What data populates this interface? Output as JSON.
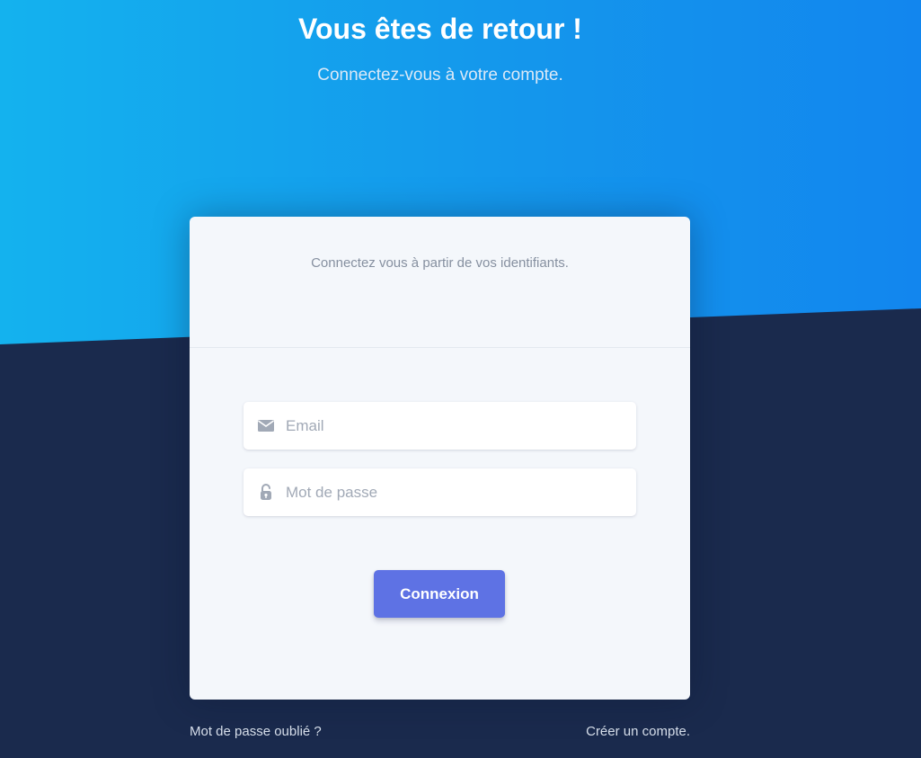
{
  "hero": {
    "title": "Vous êtes de retour !",
    "subtitle": "Connectez-vous à votre compte."
  },
  "card": {
    "header_text": "Connectez vous à partir de vos identifiants.",
    "email": {
      "placeholder": "Email",
      "value": "",
      "icon": "envelope-icon"
    },
    "password": {
      "placeholder": "Mot de passe",
      "value": "",
      "icon": "lock-icon"
    },
    "submit_label": "Connexion"
  },
  "footer": {
    "forgot_password": "Mot de passe oublié ?",
    "create_account": "Créer un compte."
  },
  "colors": {
    "gradient_start": "#14b2ee",
    "gradient_end": "#1286ee",
    "background_dark": "#1a2a4d",
    "card_background": "#f4f7fb",
    "button": "#5e72e4"
  }
}
